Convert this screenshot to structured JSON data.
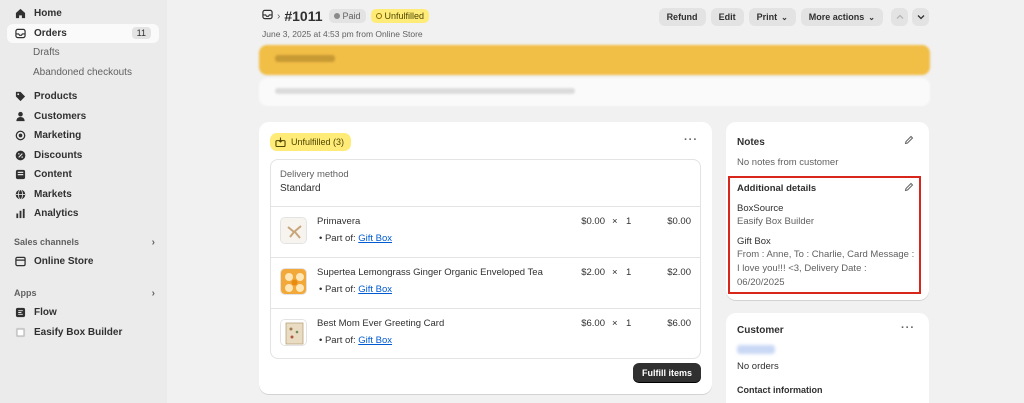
{
  "sidebar": {
    "items": [
      {
        "label": "Home",
        "icon": "home-icon"
      },
      {
        "label": "Orders",
        "icon": "orders-icon",
        "badge": "11"
      },
      {
        "label": "Products",
        "icon": "tag-icon"
      },
      {
        "label": "Customers",
        "icon": "person-icon"
      },
      {
        "label": "Marketing",
        "icon": "target-icon"
      },
      {
        "label": "Discounts",
        "icon": "discount-icon"
      },
      {
        "label": "Content",
        "icon": "content-icon"
      },
      {
        "label": "Markets",
        "icon": "globe-icon"
      },
      {
        "label": "Analytics",
        "icon": "bar-chart-icon"
      }
    ],
    "orders_sub": [
      "Drafts",
      "Abandoned checkouts"
    ],
    "sales_channels_heading": "Sales channels",
    "online_store": "Online Store",
    "apps_heading": "Apps",
    "apps": [
      "Flow",
      "Easify Box Builder"
    ]
  },
  "header": {
    "order_number": "#1011",
    "paid_label": "Paid",
    "unfulfilled_label": "Unfulfilled",
    "subtitle": "June 3, 2025 at 4:53 pm from Online Store",
    "actions": {
      "refund": "Refund",
      "edit": "Edit",
      "print": "Print",
      "more_actions": "More actions"
    }
  },
  "fulfillment": {
    "badge": "Unfulfilled (3)",
    "delivery_method_label": "Delivery method",
    "delivery_method_value": "Standard",
    "part_of_label": "Part of:",
    "part_of_link": "Gift Box",
    "items": [
      {
        "name": "Primavera",
        "price": "$0.00",
        "times": "×",
        "qty": "1",
        "total": "$0.00"
      },
      {
        "name": "Supertea Lemongrass Ginger Organic Enveloped Tea",
        "price": "$2.00",
        "times": "×",
        "qty": "1",
        "total": "$2.00"
      },
      {
        "name": "Best Mom Ever Greeting Card",
        "price": "$6.00",
        "times": "×",
        "qty": "1",
        "total": "$6.00"
      }
    ],
    "fulfill_button": "Fulfill items"
  },
  "notes": {
    "title": "Notes",
    "empty": "No notes from customer"
  },
  "additional_details": {
    "title": "Additional details",
    "field1_label": "BoxSource",
    "field1_value": "Easify Box Builder",
    "field2_label": "Gift Box",
    "field2_line1": "From : Anne, To : Charlie, Card Message :",
    "field2_line2": "I love you!!! <3, Delivery Date :",
    "field2_line3": "06/20/2025",
    "highlight_color": "#d9261c"
  },
  "customer": {
    "title": "Customer",
    "orders": "No orders",
    "contact_heading": "Contact information"
  },
  "colors": {
    "unfulfilled_bg": "#ffeb78",
    "banner_yellow": "#f1be46",
    "link": "#005bd3",
    "primary_button": "#303030"
  }
}
